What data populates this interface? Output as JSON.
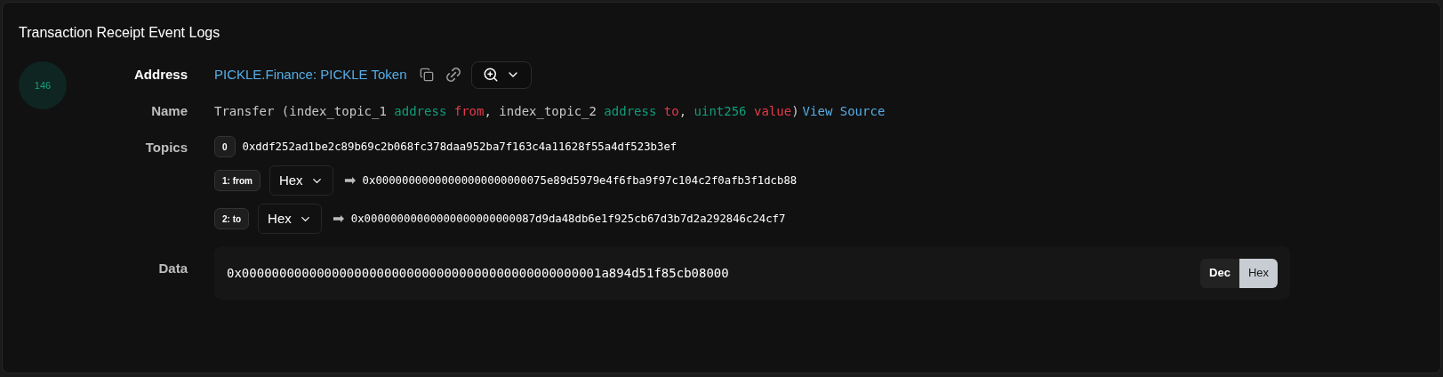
{
  "title": "Transaction Receipt Event Logs",
  "log": {
    "index": "146",
    "address": {
      "label": "Address",
      "value": "PICKLE.Finance: PICKLE Token"
    },
    "name": {
      "label": "Name",
      "segments": [
        {
          "kind": "plain",
          "text": "Transfer (index_topic_1"
        },
        {
          "kind": "type",
          "text": "address"
        },
        {
          "kind": "param",
          "text": "from"
        },
        {
          "kind": "plain",
          "text": ", index_topic_2"
        },
        {
          "kind": "type",
          "text": "address"
        },
        {
          "kind": "param",
          "text": "to"
        },
        {
          "kind": "plain",
          "text": ","
        },
        {
          "kind": "type",
          "text": "uint256"
        },
        {
          "kind": "param",
          "text": "value"
        },
        {
          "kind": "plain",
          "text": ")"
        }
      ],
      "link": "View Source"
    },
    "topics": {
      "label": "Topics",
      "items": [
        {
          "badge": "0",
          "value": "0xddf252ad1be2c89b69c2b068fc378daa952ba7f163c4a11628f55a4df523b3ef"
        },
        {
          "badge": "1: from",
          "format": "Hex",
          "arrow": "➡",
          "value": "0x00000000000000000000000075e89d5979e4f6fba9f97c104c2f0afb3f1dcb88"
        },
        {
          "badge": "2: to",
          "format": "Hex",
          "arrow": "➡",
          "value": "0x00000000000000000000000087d9da48db6e1f925cb67d3b7d2a292846c24cf7"
        }
      ]
    },
    "data": {
      "label": "Data",
      "value": "0x000000000000000000000000000000000000000000000001a894d51f85cb08000",
      "formats": [
        {
          "label": "Dec",
          "selected": false
        },
        {
          "label": "Hex",
          "selected": true
        }
      ]
    }
  }
}
